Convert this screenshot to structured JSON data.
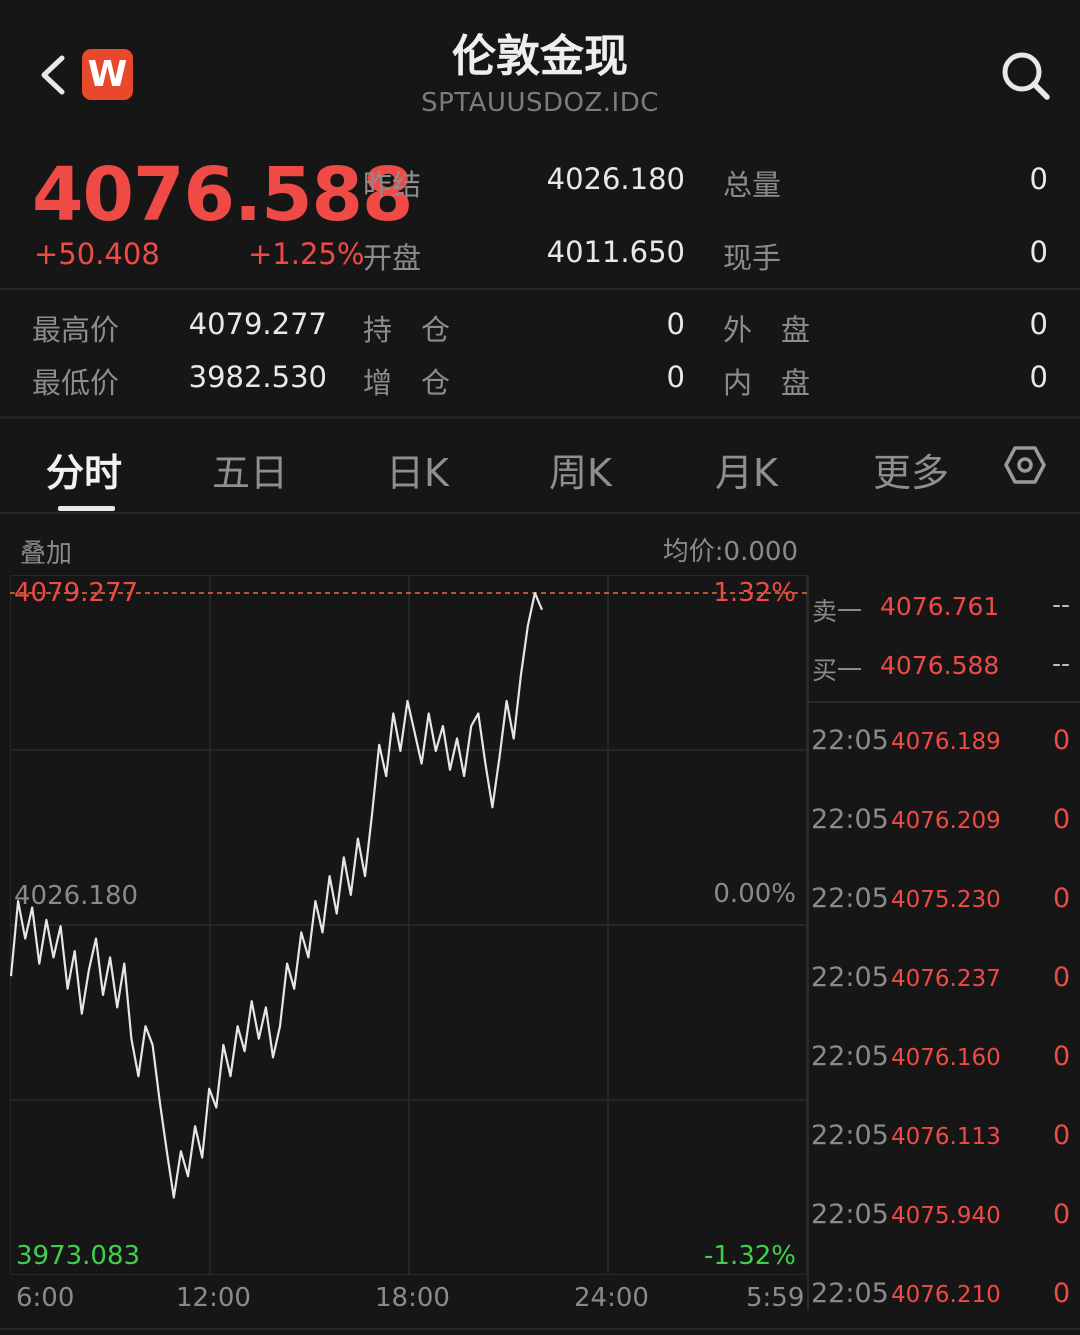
{
  "header": {
    "title": "伦敦金现",
    "subtitle": "SPTAUUSDOZ.IDC",
    "logo_letter": "W"
  },
  "quote": {
    "price": "4076.588",
    "change": "+50.408",
    "change_pct": "+1.25%",
    "fields": {
      "prev_close_label": "昨结",
      "prev_close": "4026.180",
      "volume_label": "总量",
      "volume": "0",
      "open_label": "开盘",
      "open": "4011.650",
      "current_hand_label": "现手",
      "current_hand": "0",
      "high_label": "最高价",
      "high": "4079.277",
      "position_label": "持　仓",
      "position": "0",
      "outer_label": "外　盘",
      "outer": "0",
      "low_label": "最低价",
      "low": "3982.530",
      "pos_add_label": "增　仓",
      "pos_add": "0",
      "inner_label": "内　盘",
      "inner": "0"
    }
  },
  "tabs": [
    "分时",
    "五日",
    "日K",
    "周K",
    "月K",
    "更多"
  ],
  "active_tab": "分时",
  "chart_toolbar": {
    "overlay": "叠加",
    "avg_price": "均价:0.000"
  },
  "chart_data": {
    "type": "line",
    "y_labels": {
      "top": "4079.277",
      "top_pct": "1.32%",
      "mid": "4026.180",
      "mid_pct": "0.00%",
      "bottom": "3973.083",
      "bottom_pct": "-1.32%"
    },
    "ylim": [
      3973.083,
      4079.277
    ],
    "x_ticks": [
      "6:00",
      "12:00",
      "18:00",
      "24:00",
      "5:59"
    ],
    "series": [
      {
        "values": [
          4018,
          4030,
          4024,
          4029,
          4020,
          4027,
          4021,
          4026,
          4016,
          4022,
          4012,
          4019,
          4024,
          4015,
          4021,
          4013,
          4020,
          4008,
          4002,
          4010,
          4007,
          3998,
          3990,
          3982.6,
          3990,
          3986,
          3994,
          3989,
          4000,
          3997,
          4007,
          4002,
          4010,
          4006,
          4014,
          4008,
          4013,
          4005,
          4010,
          4020,
          4016,
          4025,
          4021,
          4030,
          4025,
          4034,
          4028,
          4037,
          4031,
          4040,
          4034,
          4044,
          4055,
          4050,
          4060,
          4054,
          4062,
          4057,
          4052,
          4060,
          4054,
          4058,
          4051,
          4056,
          4050,
          4058,
          4060,
          4052,
          4045,
          4053,
          4062,
          4056,
          4066,
          4074,
          4079.277,
          4076.588
        ]
      }
    ]
  },
  "order_book": {
    "ask_label": "卖一",
    "ask": "4076.761",
    "ask_vol": "--",
    "bid_label": "买一",
    "bid": "4076.588",
    "bid_vol": "--"
  },
  "trades": [
    {
      "time": "22:05",
      "price": "4076.189",
      "vol": "0"
    },
    {
      "time": "22:05",
      "price": "4076.209",
      "vol": "0"
    },
    {
      "time": "22:05",
      "price": "4075.230",
      "vol": "0"
    },
    {
      "time": "22:05",
      "price": "4076.237",
      "vol": "0"
    },
    {
      "time": "22:05",
      "price": "4076.160",
      "vol": "0"
    },
    {
      "time": "22:05",
      "price": "4076.113",
      "vol": "0"
    },
    {
      "time": "22:05",
      "price": "4075.940",
      "vol": "0"
    },
    {
      "time": "22:05",
      "price": "4076.210",
      "vol": "0"
    }
  ],
  "colors": {
    "up": "#ef4a45",
    "down": "#3fcf4a",
    "bg": "#161616"
  }
}
